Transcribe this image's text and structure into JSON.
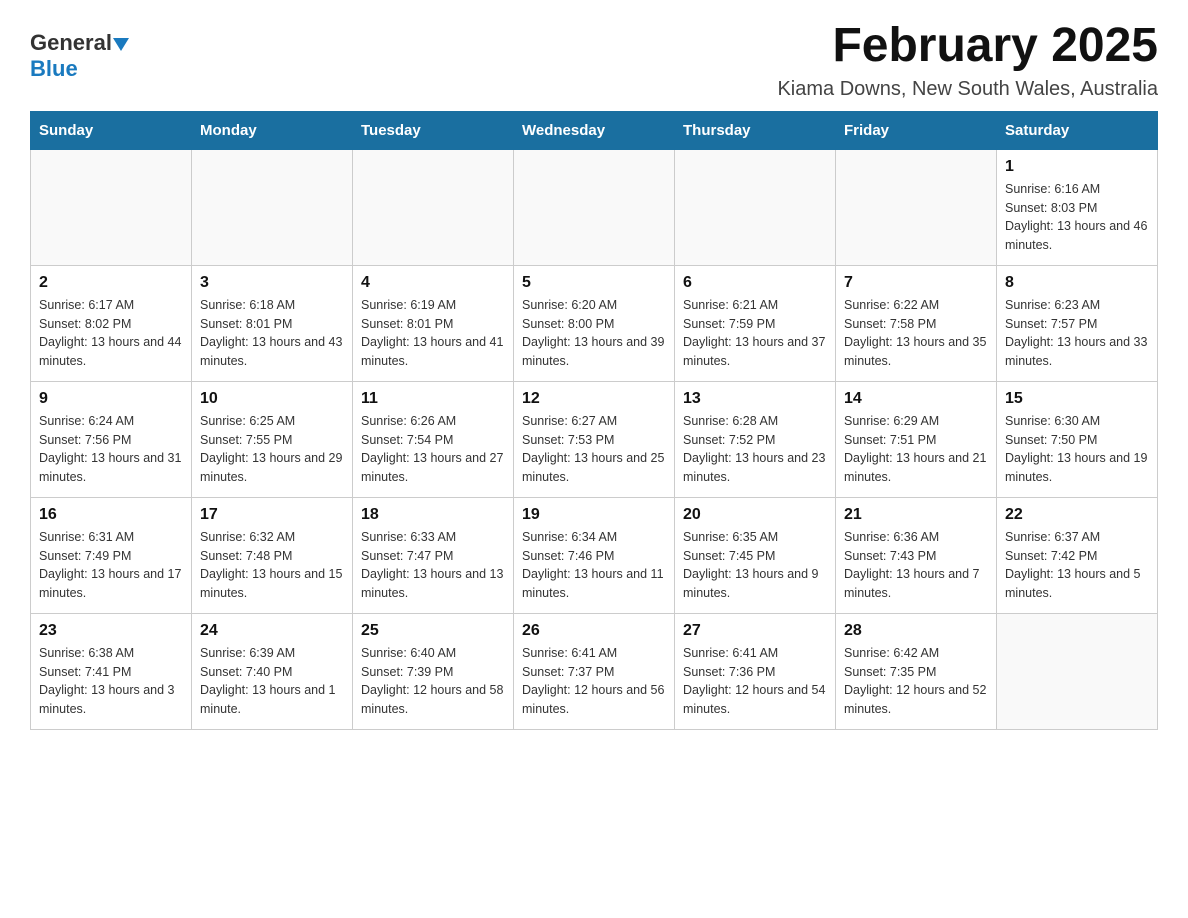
{
  "header": {
    "title": "February 2025",
    "subtitle": "Kiama Downs, New South Wales, Australia",
    "logo_general": "General",
    "logo_blue": "Blue"
  },
  "weekdays": [
    "Sunday",
    "Monday",
    "Tuesday",
    "Wednesday",
    "Thursday",
    "Friday",
    "Saturday"
  ],
  "weeks": [
    [
      {
        "day": "",
        "info": ""
      },
      {
        "day": "",
        "info": ""
      },
      {
        "day": "",
        "info": ""
      },
      {
        "day": "",
        "info": ""
      },
      {
        "day": "",
        "info": ""
      },
      {
        "day": "",
        "info": ""
      },
      {
        "day": "1",
        "info": "Sunrise: 6:16 AM\nSunset: 8:03 PM\nDaylight: 13 hours and 46 minutes."
      }
    ],
    [
      {
        "day": "2",
        "info": "Sunrise: 6:17 AM\nSunset: 8:02 PM\nDaylight: 13 hours and 44 minutes."
      },
      {
        "day": "3",
        "info": "Sunrise: 6:18 AM\nSunset: 8:01 PM\nDaylight: 13 hours and 43 minutes."
      },
      {
        "day": "4",
        "info": "Sunrise: 6:19 AM\nSunset: 8:01 PM\nDaylight: 13 hours and 41 minutes."
      },
      {
        "day": "5",
        "info": "Sunrise: 6:20 AM\nSunset: 8:00 PM\nDaylight: 13 hours and 39 minutes."
      },
      {
        "day": "6",
        "info": "Sunrise: 6:21 AM\nSunset: 7:59 PM\nDaylight: 13 hours and 37 minutes."
      },
      {
        "day": "7",
        "info": "Sunrise: 6:22 AM\nSunset: 7:58 PM\nDaylight: 13 hours and 35 minutes."
      },
      {
        "day": "8",
        "info": "Sunrise: 6:23 AM\nSunset: 7:57 PM\nDaylight: 13 hours and 33 minutes."
      }
    ],
    [
      {
        "day": "9",
        "info": "Sunrise: 6:24 AM\nSunset: 7:56 PM\nDaylight: 13 hours and 31 minutes."
      },
      {
        "day": "10",
        "info": "Sunrise: 6:25 AM\nSunset: 7:55 PM\nDaylight: 13 hours and 29 minutes."
      },
      {
        "day": "11",
        "info": "Sunrise: 6:26 AM\nSunset: 7:54 PM\nDaylight: 13 hours and 27 minutes."
      },
      {
        "day": "12",
        "info": "Sunrise: 6:27 AM\nSunset: 7:53 PM\nDaylight: 13 hours and 25 minutes."
      },
      {
        "day": "13",
        "info": "Sunrise: 6:28 AM\nSunset: 7:52 PM\nDaylight: 13 hours and 23 minutes."
      },
      {
        "day": "14",
        "info": "Sunrise: 6:29 AM\nSunset: 7:51 PM\nDaylight: 13 hours and 21 minutes."
      },
      {
        "day": "15",
        "info": "Sunrise: 6:30 AM\nSunset: 7:50 PM\nDaylight: 13 hours and 19 minutes."
      }
    ],
    [
      {
        "day": "16",
        "info": "Sunrise: 6:31 AM\nSunset: 7:49 PM\nDaylight: 13 hours and 17 minutes."
      },
      {
        "day": "17",
        "info": "Sunrise: 6:32 AM\nSunset: 7:48 PM\nDaylight: 13 hours and 15 minutes."
      },
      {
        "day": "18",
        "info": "Sunrise: 6:33 AM\nSunset: 7:47 PM\nDaylight: 13 hours and 13 minutes."
      },
      {
        "day": "19",
        "info": "Sunrise: 6:34 AM\nSunset: 7:46 PM\nDaylight: 13 hours and 11 minutes."
      },
      {
        "day": "20",
        "info": "Sunrise: 6:35 AM\nSunset: 7:45 PM\nDaylight: 13 hours and 9 minutes."
      },
      {
        "day": "21",
        "info": "Sunrise: 6:36 AM\nSunset: 7:43 PM\nDaylight: 13 hours and 7 minutes."
      },
      {
        "day": "22",
        "info": "Sunrise: 6:37 AM\nSunset: 7:42 PM\nDaylight: 13 hours and 5 minutes."
      }
    ],
    [
      {
        "day": "23",
        "info": "Sunrise: 6:38 AM\nSunset: 7:41 PM\nDaylight: 13 hours and 3 minutes."
      },
      {
        "day": "24",
        "info": "Sunrise: 6:39 AM\nSunset: 7:40 PM\nDaylight: 13 hours and 1 minute."
      },
      {
        "day": "25",
        "info": "Sunrise: 6:40 AM\nSunset: 7:39 PM\nDaylight: 12 hours and 58 minutes."
      },
      {
        "day": "26",
        "info": "Sunrise: 6:41 AM\nSunset: 7:37 PM\nDaylight: 12 hours and 56 minutes."
      },
      {
        "day": "27",
        "info": "Sunrise: 6:41 AM\nSunset: 7:36 PM\nDaylight: 12 hours and 54 minutes."
      },
      {
        "day": "28",
        "info": "Sunrise: 6:42 AM\nSunset: 7:35 PM\nDaylight: 12 hours and 52 minutes."
      },
      {
        "day": "",
        "info": ""
      }
    ]
  ]
}
